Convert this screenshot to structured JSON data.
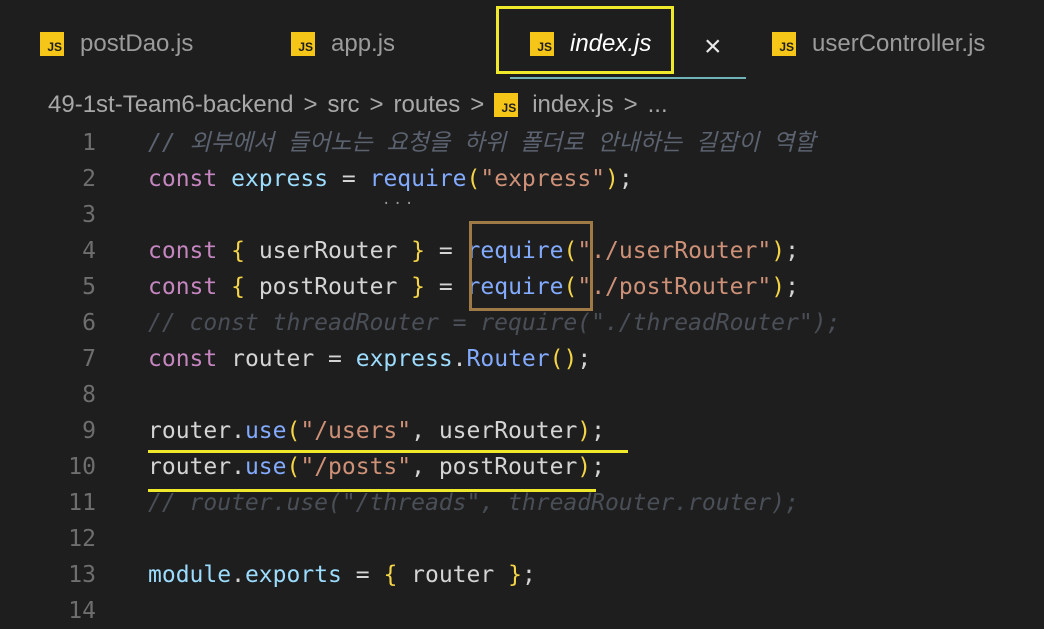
{
  "tabs": [
    {
      "label": "postDao.js",
      "icon": "js-file-icon",
      "badge": "JS"
    },
    {
      "label": "app.js",
      "icon": "js-file-icon",
      "badge": "JS"
    },
    {
      "label": "index.js",
      "icon": "js-file-icon",
      "badge": "JS",
      "active": true
    },
    {
      "label": "userController.js",
      "icon": "js-file-icon",
      "badge": "JS"
    }
  ],
  "close_glyph": "×",
  "breadcrumb": {
    "items": [
      "49-1st-Team6-backend",
      "src",
      "routes",
      "index.js",
      "..."
    ],
    "separator": ">",
    "badge": "JS"
  },
  "code_lines": [
    {
      "n": "1",
      "tokens": [
        [
          "cmt",
          "// 외부에서 들어노는 요청을 하위 폴더로 안내하는 길잡이 역할"
        ]
      ]
    },
    {
      "n": "2",
      "tokens": [
        [
          "kw",
          "const"
        ],
        [
          "pun",
          " "
        ],
        [
          "var",
          "express"
        ],
        [
          "pun",
          " = "
        ],
        [
          "fn",
          "require"
        ],
        [
          "br",
          "("
        ],
        [
          "str",
          "\"express\""
        ],
        [
          "br",
          ")"
        ],
        [
          "pun",
          ";"
        ]
      ]
    },
    {
      "n": "3",
      "tokens": []
    },
    {
      "n": "4",
      "tokens": [
        [
          "kw",
          "const"
        ],
        [
          "pun",
          " "
        ],
        [
          "br",
          "{"
        ],
        [
          "pun",
          " userRouter "
        ],
        [
          "br",
          "}"
        ],
        [
          "pun",
          " = "
        ],
        [
          "fn",
          "require"
        ],
        [
          "br",
          "("
        ],
        [
          "str",
          "\"./userRouter\""
        ],
        [
          "br",
          ")"
        ],
        [
          "pun",
          ";"
        ]
      ]
    },
    {
      "n": "5",
      "tokens": [
        [
          "kw",
          "const"
        ],
        [
          "pun",
          " "
        ],
        [
          "br",
          "{"
        ],
        [
          "pun",
          " postRouter "
        ],
        [
          "br",
          "}"
        ],
        [
          "pun",
          " = "
        ],
        [
          "fn",
          "require"
        ],
        [
          "br",
          "("
        ],
        [
          "str",
          "\"./postRouter\""
        ],
        [
          "br",
          ")"
        ],
        [
          "pun",
          ";"
        ]
      ]
    },
    {
      "n": "6",
      "tokens": [
        [
          "cmt-dim",
          "// const threadRouter = require(\"./threadRouter\");"
        ]
      ]
    },
    {
      "n": "7",
      "tokens": [
        [
          "kw",
          "const"
        ],
        [
          "pun",
          " router = "
        ],
        [
          "var",
          "express"
        ],
        [
          "pun",
          "."
        ],
        [
          "fn",
          "Router"
        ],
        [
          "br",
          "()"
        ],
        [
          "pun",
          ";"
        ]
      ]
    },
    {
      "n": "8",
      "tokens": []
    },
    {
      "n": "9",
      "tokens": [
        [
          "pun",
          "router."
        ],
        [
          "fn",
          "use"
        ],
        [
          "br",
          "("
        ],
        [
          "str",
          "\"/users\""
        ],
        [
          "pun",
          ", userRouter"
        ],
        [
          "br",
          ")"
        ],
        [
          "pun",
          ";"
        ]
      ]
    },
    {
      "n": "10",
      "tokens": [
        [
          "pun",
          "router."
        ],
        [
          "fn",
          "use"
        ],
        [
          "br",
          "("
        ],
        [
          "str",
          "\"/posts\""
        ],
        [
          "pun",
          ", postRouter"
        ],
        [
          "br",
          ")"
        ],
        [
          "pun",
          ";"
        ]
      ]
    },
    {
      "n": "11",
      "tokens": [
        [
          "cmt-dim",
          "// router.use(\"/threads\", threadRouter.router);"
        ]
      ]
    },
    {
      "n": "12",
      "tokens": []
    },
    {
      "n": "13",
      "tokens": [
        [
          "var",
          "module"
        ],
        [
          "pun",
          "."
        ],
        [
          "var",
          "exports"
        ],
        [
          "pun",
          " = "
        ],
        [
          "br",
          "{"
        ],
        [
          "pun",
          " router "
        ],
        [
          "br",
          "}"
        ],
        [
          "pun",
          ";"
        ]
      ]
    },
    {
      "n": "14",
      "tokens": []
    }
  ],
  "colors": {
    "editor_bg": "#1e1e1e",
    "keyword": "#c586c0",
    "variable": "#9cdcfe",
    "function": "#82aaff",
    "string": "#ce9178",
    "bracket": "#f5d547",
    "js_badge": "#f5c518",
    "highlight_yellow": "#f0e82a",
    "highlight_brown": "#a07a46"
  }
}
